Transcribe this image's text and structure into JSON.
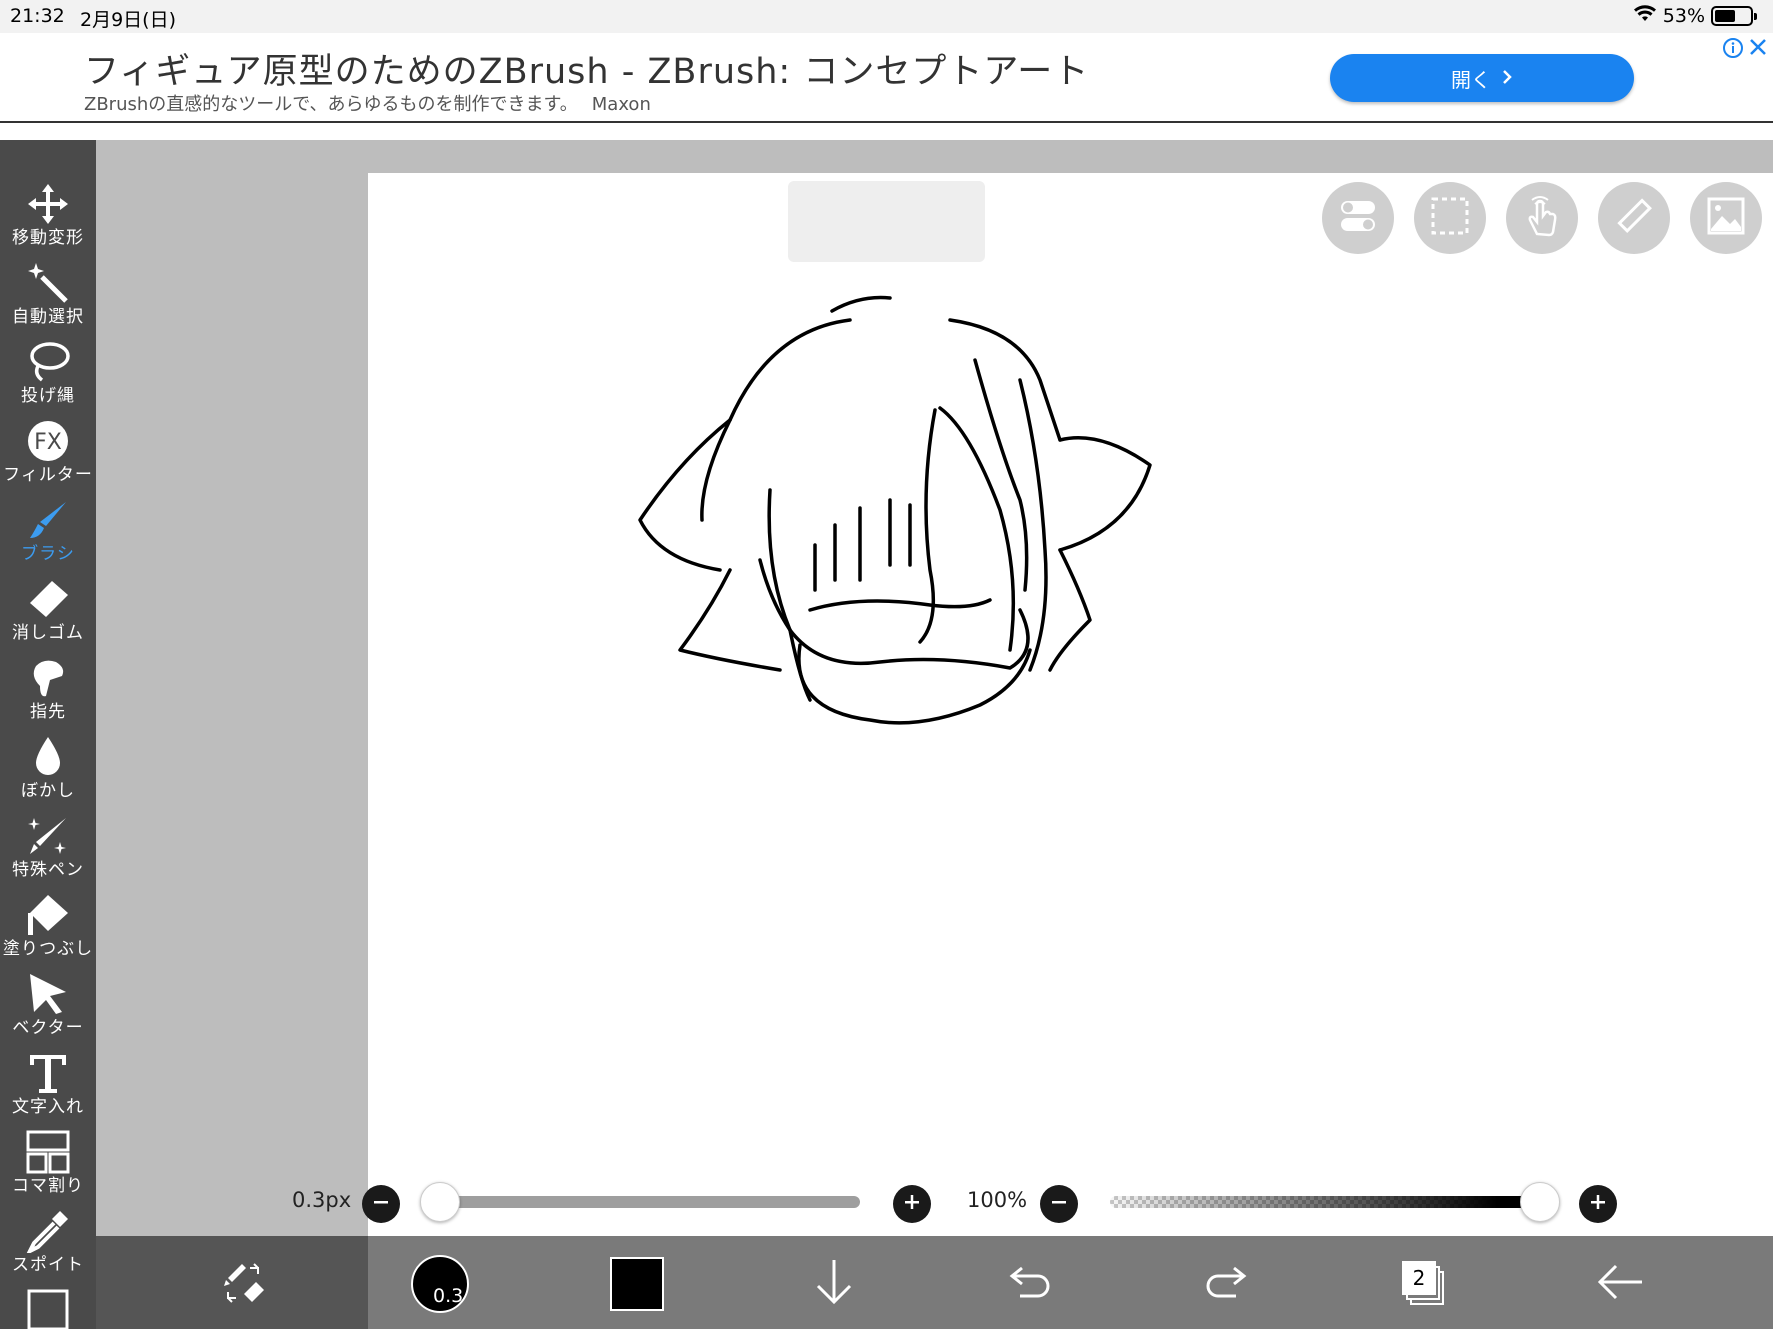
{
  "status_bar": {
    "time": "21:32",
    "date": "2月9日(日)",
    "battery": "53%"
  },
  "ad": {
    "headline": "フィギュア原型のためのZBrush - ZBrush: コンセプトアート",
    "sub": "ZBrushの直感的なツールで、あらゆるものを制作できます。",
    "brand": "Maxon",
    "open_label": "開く"
  },
  "tools": [
    {
      "label": "移動変形",
      "icon": "move-icon",
      "active": false
    },
    {
      "label": "自動選択",
      "icon": "magic-wand-icon",
      "active": false
    },
    {
      "label": "投げ縄",
      "icon": "lasso-icon",
      "active": false
    },
    {
      "label": "フィルター",
      "icon": "fx-icon",
      "active": false
    },
    {
      "label": "ブラシ",
      "icon": "brush-icon",
      "active": true
    },
    {
      "label": "消しゴム",
      "icon": "eraser-icon",
      "active": false
    },
    {
      "label": "指先",
      "icon": "finger-icon",
      "active": false
    },
    {
      "label": "ぼかし",
      "icon": "blur-drop-icon",
      "active": false
    },
    {
      "label": "特殊ペン",
      "icon": "special-pen-icon",
      "active": false
    },
    {
      "label": "塗りつぶし",
      "icon": "fill-bucket-icon",
      "active": false
    },
    {
      "label": "ベクター",
      "icon": "vector-arrow-icon",
      "active": false
    },
    {
      "label": "文字入れ",
      "icon": "text-icon",
      "active": false
    },
    {
      "label": "コマ割り",
      "icon": "panel-icon",
      "active": false
    },
    {
      "label": "スポイト",
      "icon": "eyedropper-icon",
      "active": false
    }
  ],
  "brush": {
    "size_label": "0.3px",
    "size_value": 0.3,
    "size_fraction": 0.0,
    "opacity_label": "100%",
    "opacity_fraction": 1.0
  },
  "bottom_bar": {
    "brush_size_badge": "0.3",
    "layer_count": "2",
    "color": "#000000"
  },
  "colors": {
    "accent": "#3c9cf0",
    "ad_button": "#1a83f0",
    "toolbar": "#4a4a4a"
  }
}
